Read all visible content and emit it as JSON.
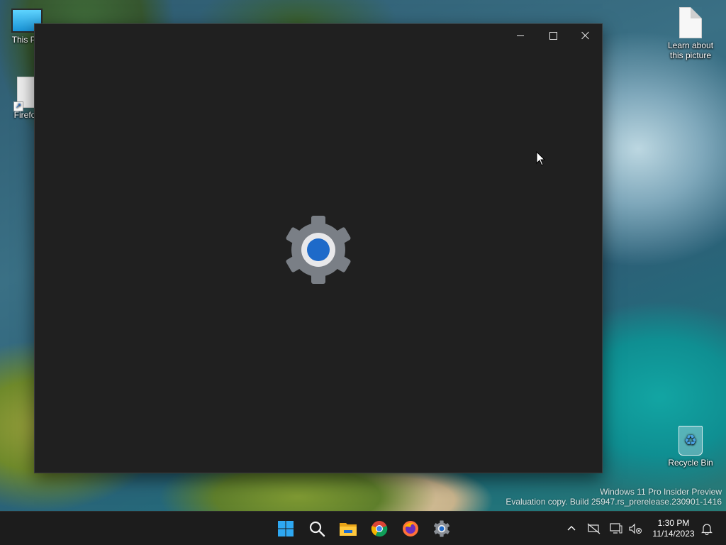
{
  "desktop": {
    "icons": [
      {
        "label": "This PC",
        "icon": "this-pc-icon"
      },
      {
        "label": "Firefox",
        "icon": "firefox-shortcut-icon"
      },
      {
        "label": "Learn about this picture",
        "icon": "document-icon"
      },
      {
        "label": "Recycle Bin",
        "icon": "recycle-bin-icon"
      }
    ],
    "watermark": {
      "line1": "Windows 11 Pro Insider Preview",
      "line2": "Evaluation copy. Build 25947.rs_prerelease.230901-1416"
    }
  },
  "window": {
    "title": "Settings",
    "splash_icon": "settings-gear-icon",
    "background": "#202020",
    "accent": "#1e6ac9",
    "controls": {
      "minimize": "minimize-icon",
      "maximize": "maximize-icon",
      "close": "close-icon"
    }
  },
  "taskbar": {
    "background": "#1c1c1c",
    "apps": [
      {
        "name": "Start",
        "icon": "windows-start-icon"
      },
      {
        "name": "Search",
        "icon": "search-icon"
      },
      {
        "name": "File Explorer",
        "icon": "file-explorer-icon"
      },
      {
        "name": "Google Chrome",
        "icon": "chrome-icon"
      },
      {
        "name": "Firefox",
        "icon": "firefox-icon"
      },
      {
        "name": "Settings",
        "icon": "settings-icon"
      }
    ],
    "tray": {
      "chevron": "show-hidden-icons-icon",
      "network": "network-disconnected-icon",
      "display": "display-icon",
      "volume": "volume-muted-icon",
      "time": "1:30 PM",
      "date": "11/14/2023",
      "notifications": "notification-bell-icon"
    }
  }
}
